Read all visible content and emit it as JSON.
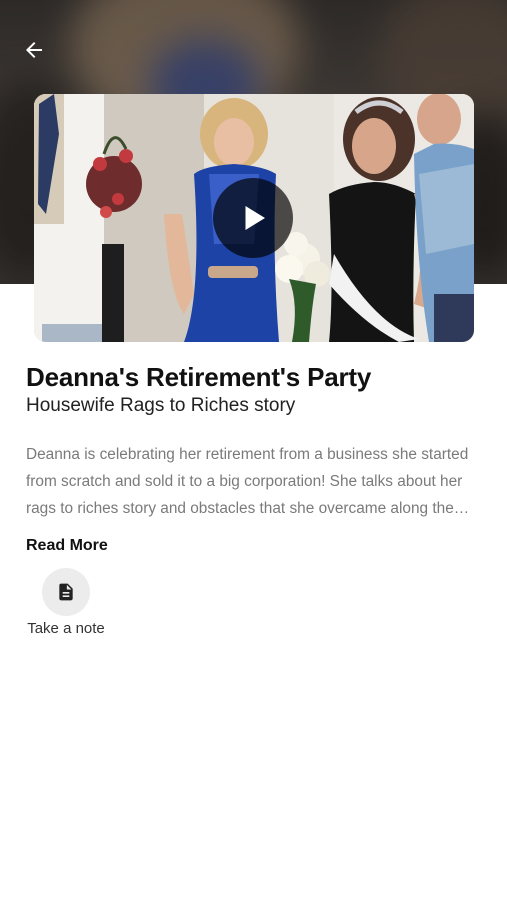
{
  "header": {
    "back_icon": "arrow-left-icon"
  },
  "video": {
    "play_icon": "play-icon"
  },
  "content": {
    "title": "Deanna's Retirement's Party",
    "subtitle": "Housewife Rags to Riches story",
    "description": "Deanna is celebrating her retirement from a business she started from scratch and sold it to a big corporation! She talks about her rags to riches story and obstacles that she overcame along the way.",
    "read_more_label": "Read More"
  },
  "actions": {
    "take_note_label": "Take a note",
    "take_note_icon": "note-document-icon"
  },
  "colors": {
    "background": "#ffffff",
    "title": "#111111",
    "description": "#7a7a7a",
    "note_circle": "#ececec"
  }
}
